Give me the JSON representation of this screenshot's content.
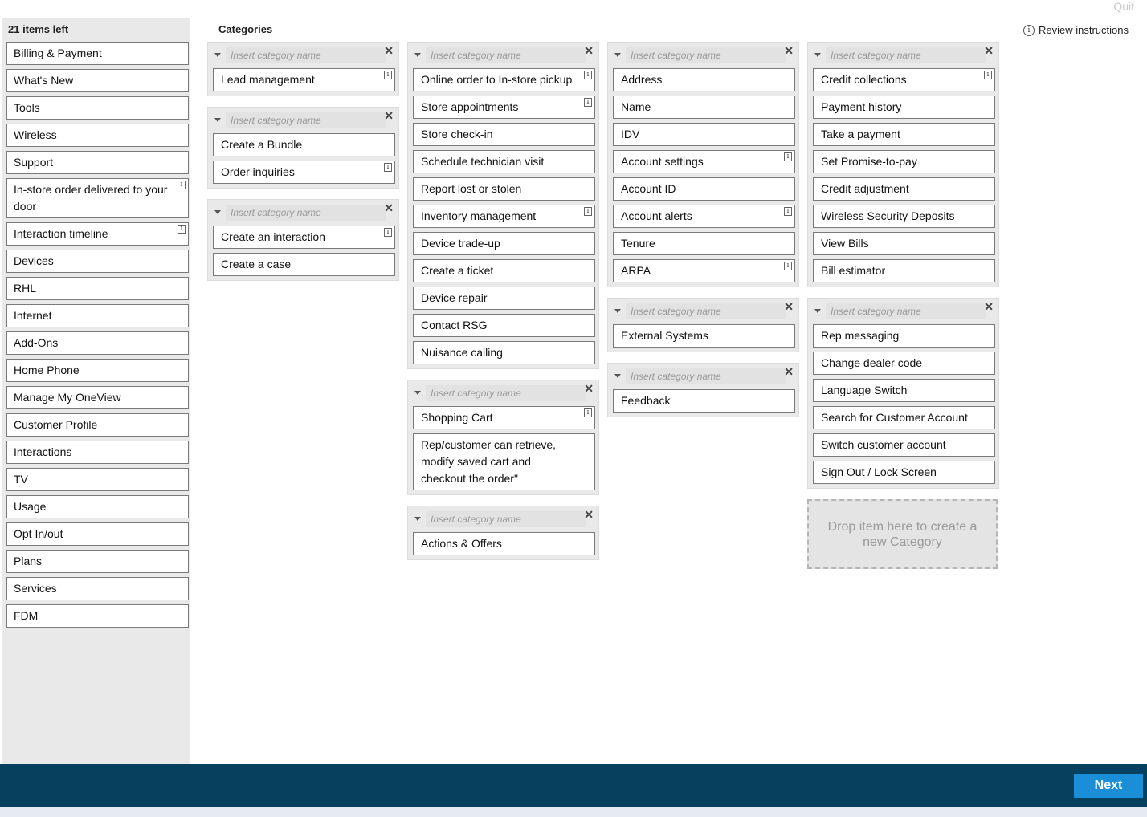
{
  "header": {
    "quit_label": "Quit",
    "review_label": "Review instructions",
    "categories_title": "Categories"
  },
  "sidebar": {
    "items_left": "21 items left",
    "items": [
      {
        "label": "Billing & Payment",
        "info": false
      },
      {
        "label": "What's New",
        "info": false
      },
      {
        "label": "Tools",
        "info": false
      },
      {
        "label": "Wireless",
        "info": false
      },
      {
        "label": "Support",
        "info": false
      },
      {
        "label": "In-store order delivered to your door",
        "info": true
      },
      {
        "label": "Interaction timeline",
        "info": true
      },
      {
        "label": "Devices",
        "info": false
      },
      {
        "label": "RHL",
        "info": false
      },
      {
        "label": "Internet",
        "info": false
      },
      {
        "label": "Add-Ons",
        "info": false
      },
      {
        "label": "Home Phone",
        "info": false
      },
      {
        "label": "Manage My OneView",
        "info": false
      },
      {
        "label": "Customer Profile",
        "info": false
      },
      {
        "label": "Interactions",
        "info": false
      },
      {
        "label": "TV",
        "info": false
      },
      {
        "label": "Usage",
        "info": false
      },
      {
        "label": "Opt In/out",
        "info": false
      },
      {
        "label": "Plans",
        "info": false
      },
      {
        "label": "Services",
        "info": false
      },
      {
        "label": "FDM",
        "info": false
      }
    ]
  },
  "category_placeholder": "Insert category name",
  "close_glyph": "✕",
  "info_glyph": "i",
  "groups": [
    {
      "items": [
        {
          "label": "Lead management",
          "info": true
        }
      ]
    },
    {
      "items": [
        {
          "label": "Create a Bundle",
          "info": false
        },
        {
          "label": "Order inquiries",
          "info": true
        }
      ]
    },
    {
      "items": [
        {
          "label": "Create an interaction",
          "info": true
        },
        {
          "label": "Create a case",
          "info": false
        }
      ]
    },
    {
      "items": [
        {
          "label": "Online order to In-store pickup",
          "info": true
        },
        {
          "label": "Store appointments",
          "info": true
        },
        {
          "label": "Store check-in",
          "info": false
        },
        {
          "label": "Schedule technician visit",
          "info": false
        },
        {
          "label": "Report lost or stolen",
          "info": false
        },
        {
          "label": "Inventory management",
          "info": true
        },
        {
          "label": "Device trade-up",
          "info": false
        },
        {
          "label": "Create a ticket",
          "info": false
        },
        {
          "label": "Device repair",
          "info": false
        },
        {
          "label": "Contact RSG",
          "info": false
        },
        {
          "label": "Nuisance calling",
          "info": false
        }
      ]
    },
    {
      "items": [
        {
          "label": "Shopping Cart",
          "info": true
        },
        {
          "label": "Rep/customer can retrieve, modify saved cart and checkout the order\"",
          "info": false
        }
      ]
    },
    {
      "items": [
        {
          "label": "Actions & Offers",
          "info": false
        }
      ]
    },
    {
      "items": [
        {
          "label": "Address",
          "info": false
        },
        {
          "label": "Name",
          "info": false
        },
        {
          "label": "IDV",
          "info": false
        },
        {
          "label": "Account settings",
          "info": true
        },
        {
          "label": "Account ID",
          "info": false
        },
        {
          "label": "Account alerts",
          "info": true
        },
        {
          "label": "Tenure",
          "info": false
        },
        {
          "label": "ARPA",
          "info": true
        }
      ]
    },
    {
      "items": [
        {
          "label": "External Systems",
          "info": false
        }
      ]
    },
    {
      "items": [
        {
          "label": "Feedback",
          "info": false
        }
      ]
    },
    {
      "items": [
        {
          "label": "Credit collections",
          "info": true
        },
        {
          "label": "Payment history",
          "info": false
        },
        {
          "label": "Take a payment",
          "info": false
        },
        {
          "label": "Set Promise-to-pay",
          "info": false
        },
        {
          "label": "Credit adjustment",
          "info": false
        },
        {
          "label": "Wireless Security Deposits",
          "info": false
        },
        {
          "label": "View Bills",
          "info": false
        },
        {
          "label": "Bill estimator",
          "info": false
        }
      ]
    },
    {
      "items": [
        {
          "label": "Rep messaging",
          "info": false
        },
        {
          "label": "Change dealer code",
          "info": false
        },
        {
          "label": "Language Switch",
          "info": false
        },
        {
          "label": "Search for Customer Account",
          "info": false
        },
        {
          "label": "Switch customer account",
          "info": false
        },
        {
          "label": "Sign Out / Lock Screen",
          "info": false
        }
      ]
    }
  ],
  "dropzone_label": "Drop item here to create a new Category",
  "footer": {
    "next_label": "Next",
    "bar_color": "#05415f",
    "button_color": "#1a8fd8"
  }
}
